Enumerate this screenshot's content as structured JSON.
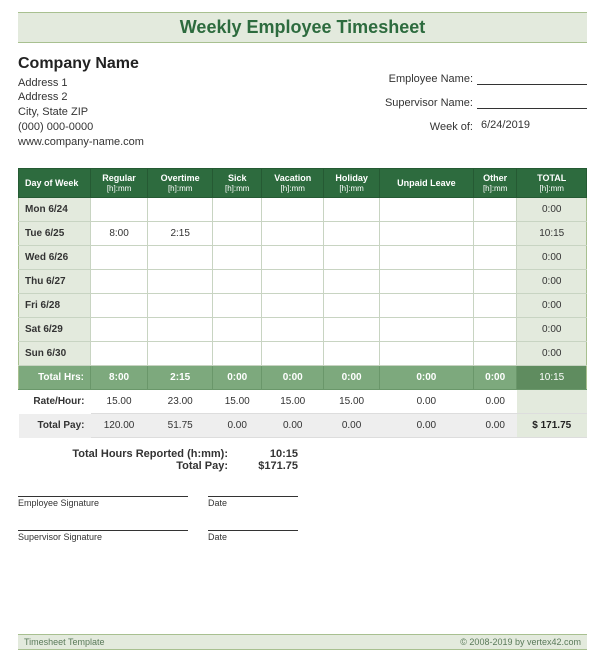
{
  "title": "Weekly Employee Timesheet",
  "company": {
    "name": "Company Name",
    "address1": "Address 1",
    "address2": "Address 2",
    "cityStateZip": "City, State  ZIP",
    "phone": "(000) 000-0000",
    "website": "www.company-name.com"
  },
  "meta": {
    "employeeLabel": "Employee Name:",
    "employeeValue": "",
    "supervisorLabel": "Supervisor Name:",
    "supervisorValue": "",
    "weekOfLabel": "Week of:",
    "weekOfValue": "6/24/2019"
  },
  "columns": {
    "day": "Day of Week",
    "regular": "Regular",
    "overtime": "Overtime",
    "sick": "Sick",
    "vacation": "Vacation",
    "holiday": "Holiday",
    "unpaid": "Unpaid Leave",
    "other": "Other",
    "total": "TOTAL",
    "unit": "[h]:mm"
  },
  "rows": [
    {
      "day": "Mon 6/24",
      "regular": "",
      "overtime": "",
      "sick": "",
      "vacation": "",
      "holiday": "",
      "unpaid": "",
      "other": "",
      "total": "0:00"
    },
    {
      "day": "Tue 6/25",
      "regular": "8:00",
      "overtime": "2:15",
      "sick": "",
      "vacation": "",
      "holiday": "",
      "unpaid": "",
      "other": "",
      "total": "10:15"
    },
    {
      "day": "Wed 6/26",
      "regular": "",
      "overtime": "",
      "sick": "",
      "vacation": "",
      "holiday": "",
      "unpaid": "",
      "other": "",
      "total": "0:00"
    },
    {
      "day": "Thu 6/27",
      "regular": "",
      "overtime": "",
      "sick": "",
      "vacation": "",
      "holiday": "",
      "unpaid": "",
      "other": "",
      "total": "0:00"
    },
    {
      "day": "Fri 6/28",
      "regular": "",
      "overtime": "",
      "sick": "",
      "vacation": "",
      "holiday": "",
      "unpaid": "",
      "other": "",
      "total": "0:00"
    },
    {
      "day": "Sat 6/29",
      "regular": "",
      "overtime": "",
      "sick": "",
      "vacation": "",
      "holiday": "",
      "unpaid": "",
      "other": "",
      "total": "0:00"
    },
    {
      "day": "Sun 6/30",
      "regular": "",
      "overtime": "",
      "sick": "",
      "vacation": "",
      "holiday": "",
      "unpaid": "",
      "other": "",
      "total": "0:00"
    }
  ],
  "totals": {
    "hrsLabel": "Total Hrs:",
    "hrs": {
      "regular": "8:00",
      "overtime": "2:15",
      "sick": "0:00",
      "vacation": "0:00",
      "holiday": "0:00",
      "unpaid": "0:00",
      "other": "0:00",
      "total": "10:15"
    },
    "rateLabel": "Rate/Hour:",
    "rate": {
      "regular": "15.00",
      "overtime": "23.00",
      "sick": "15.00",
      "vacation": "15.00",
      "holiday": "15.00",
      "unpaid": "0.00",
      "other": "0.00",
      "total": ""
    },
    "payLabel": "Total Pay:",
    "pay": {
      "regular": "120.00",
      "overtime": "51.75",
      "sick": "0.00",
      "vacation": "0.00",
      "holiday": "0.00",
      "unpaid": "0.00",
      "other": "0.00",
      "total": "$   171.75"
    }
  },
  "summary": {
    "hoursLabel": "Total Hours Reported (h:mm):",
    "hoursValue": "10:15",
    "payLabel": "Total Pay:",
    "payValue": "$171.75"
  },
  "signatures": {
    "employee": "Employee Signature",
    "supervisor": "Supervisor Signature",
    "date": "Date"
  },
  "footer": {
    "left": "Timesheet Template",
    "right": "© 2008-2019 by vertex42.com"
  }
}
